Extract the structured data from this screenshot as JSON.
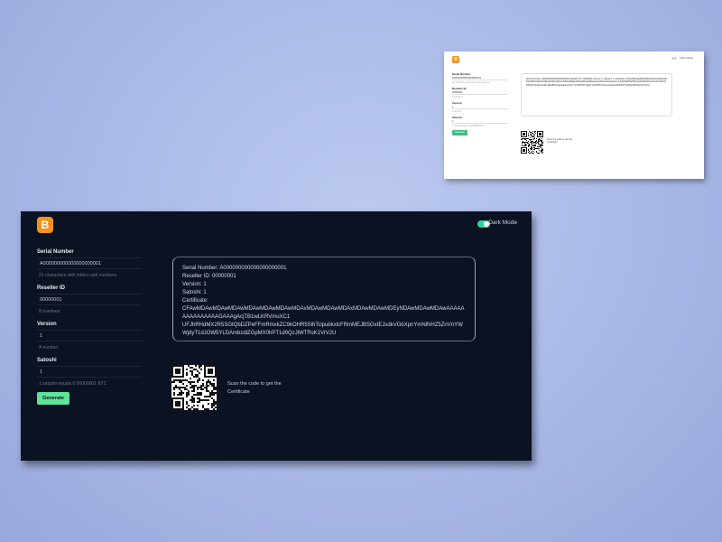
{
  "light": {
    "logo": "B",
    "dark_mode_label": "Dark Mode",
    "fields": [
      {
        "label": "Serial Number",
        "value": "A000000000000000000001",
        "hint": "21 characters with letters and numbers"
      },
      {
        "label": "Reseller ID",
        "value": "00000001",
        "hint": "8 numbers"
      },
      {
        "label": "Version",
        "value": "1",
        "hint": "A number"
      },
      {
        "label": "Satoshi",
        "value": "1",
        "hint": "1 satoshi equals 0.00000001 BTC"
      }
    ],
    "generate_label": "Generate",
    "cert_lines": [
      "Serial Number: A000000000000000000001",
      "Reseller ID: 00000001",
      "Version: 1",
      "Satoshi: 1",
      "Certificate:",
      "CFAwMDAwMDAwMDAwMDAwMDAwMDAwMDAxMDAwMDAwMDAxMDAwMDAwMDEyNDAwMDAwMDAwAAAAAAAAAAAAAA",
      "UFJhRHdMX2R5SGtQbDZPeFFmRmxkZC9kOHR5SlhTclpubkxlcFRmMEJBSGxIEJsdkVGbXpnYmNlNHZ5",
      "WjdyT1dJOW5YLDAmbzdlZGpMX0hPT1d0QzJiWTRsK1VrV2U"
    ],
    "qr_text": "Scan the code to get the Certificate"
  },
  "dark": {
    "logo": "B",
    "dark_mode_label": "Dark Mode",
    "fields": [
      {
        "label": "Serial Number",
        "value": "A000000000000000000001",
        "hint": "21 characters with letters and numbers"
      },
      {
        "label": "Reseller ID",
        "value": "00000001",
        "hint": "8 numbers"
      },
      {
        "label": "Version",
        "value": "1",
        "hint": "A number"
      },
      {
        "label": "Satoshi",
        "value": "1",
        "hint": "1 satoshi equals 0.00000001 BTC"
      }
    ],
    "generate_label": "Generate",
    "cert_lines": [
      "Serial Number: A000000000000000000001",
      "Reseller ID: 00000001",
      "Version: 1",
      "Satoshi: 1",
      "Certificate:",
      "CFAwMDAwMDAwMDAwMDAwMDAwMDAwMDAxMDAwMDAwMDAxMDAwMDAwMDEyNDAwMDAwMDAwAAAAAAAAAAAAAAAGAAAgAcjTB1wLKRVmuXC1",
      "UFJhRHdMX2R5SGtQbDZPeFFmRmxkZC9kOHR5SlhTclpubkxlcFRmMEJBSGxIEJsdkVGbXpnYmNlNHZ5ZnVnYW",
      "WjdyT1dJOW5YLDAmbzdlZGpMX0hPT1d0QzJiWTRsK1VrV2U"
    ],
    "qr_text": "Scan the code to get the Certificate"
  },
  "colors": {
    "accent_orange": "#f7931a",
    "accent_green": "#5ee39a",
    "dark_bg": "#0b1222"
  },
  "icons": {
    "logo": "bitcoin-logo-icon",
    "toggle": "toggle-switch-icon",
    "qr": "qr-code-icon"
  }
}
